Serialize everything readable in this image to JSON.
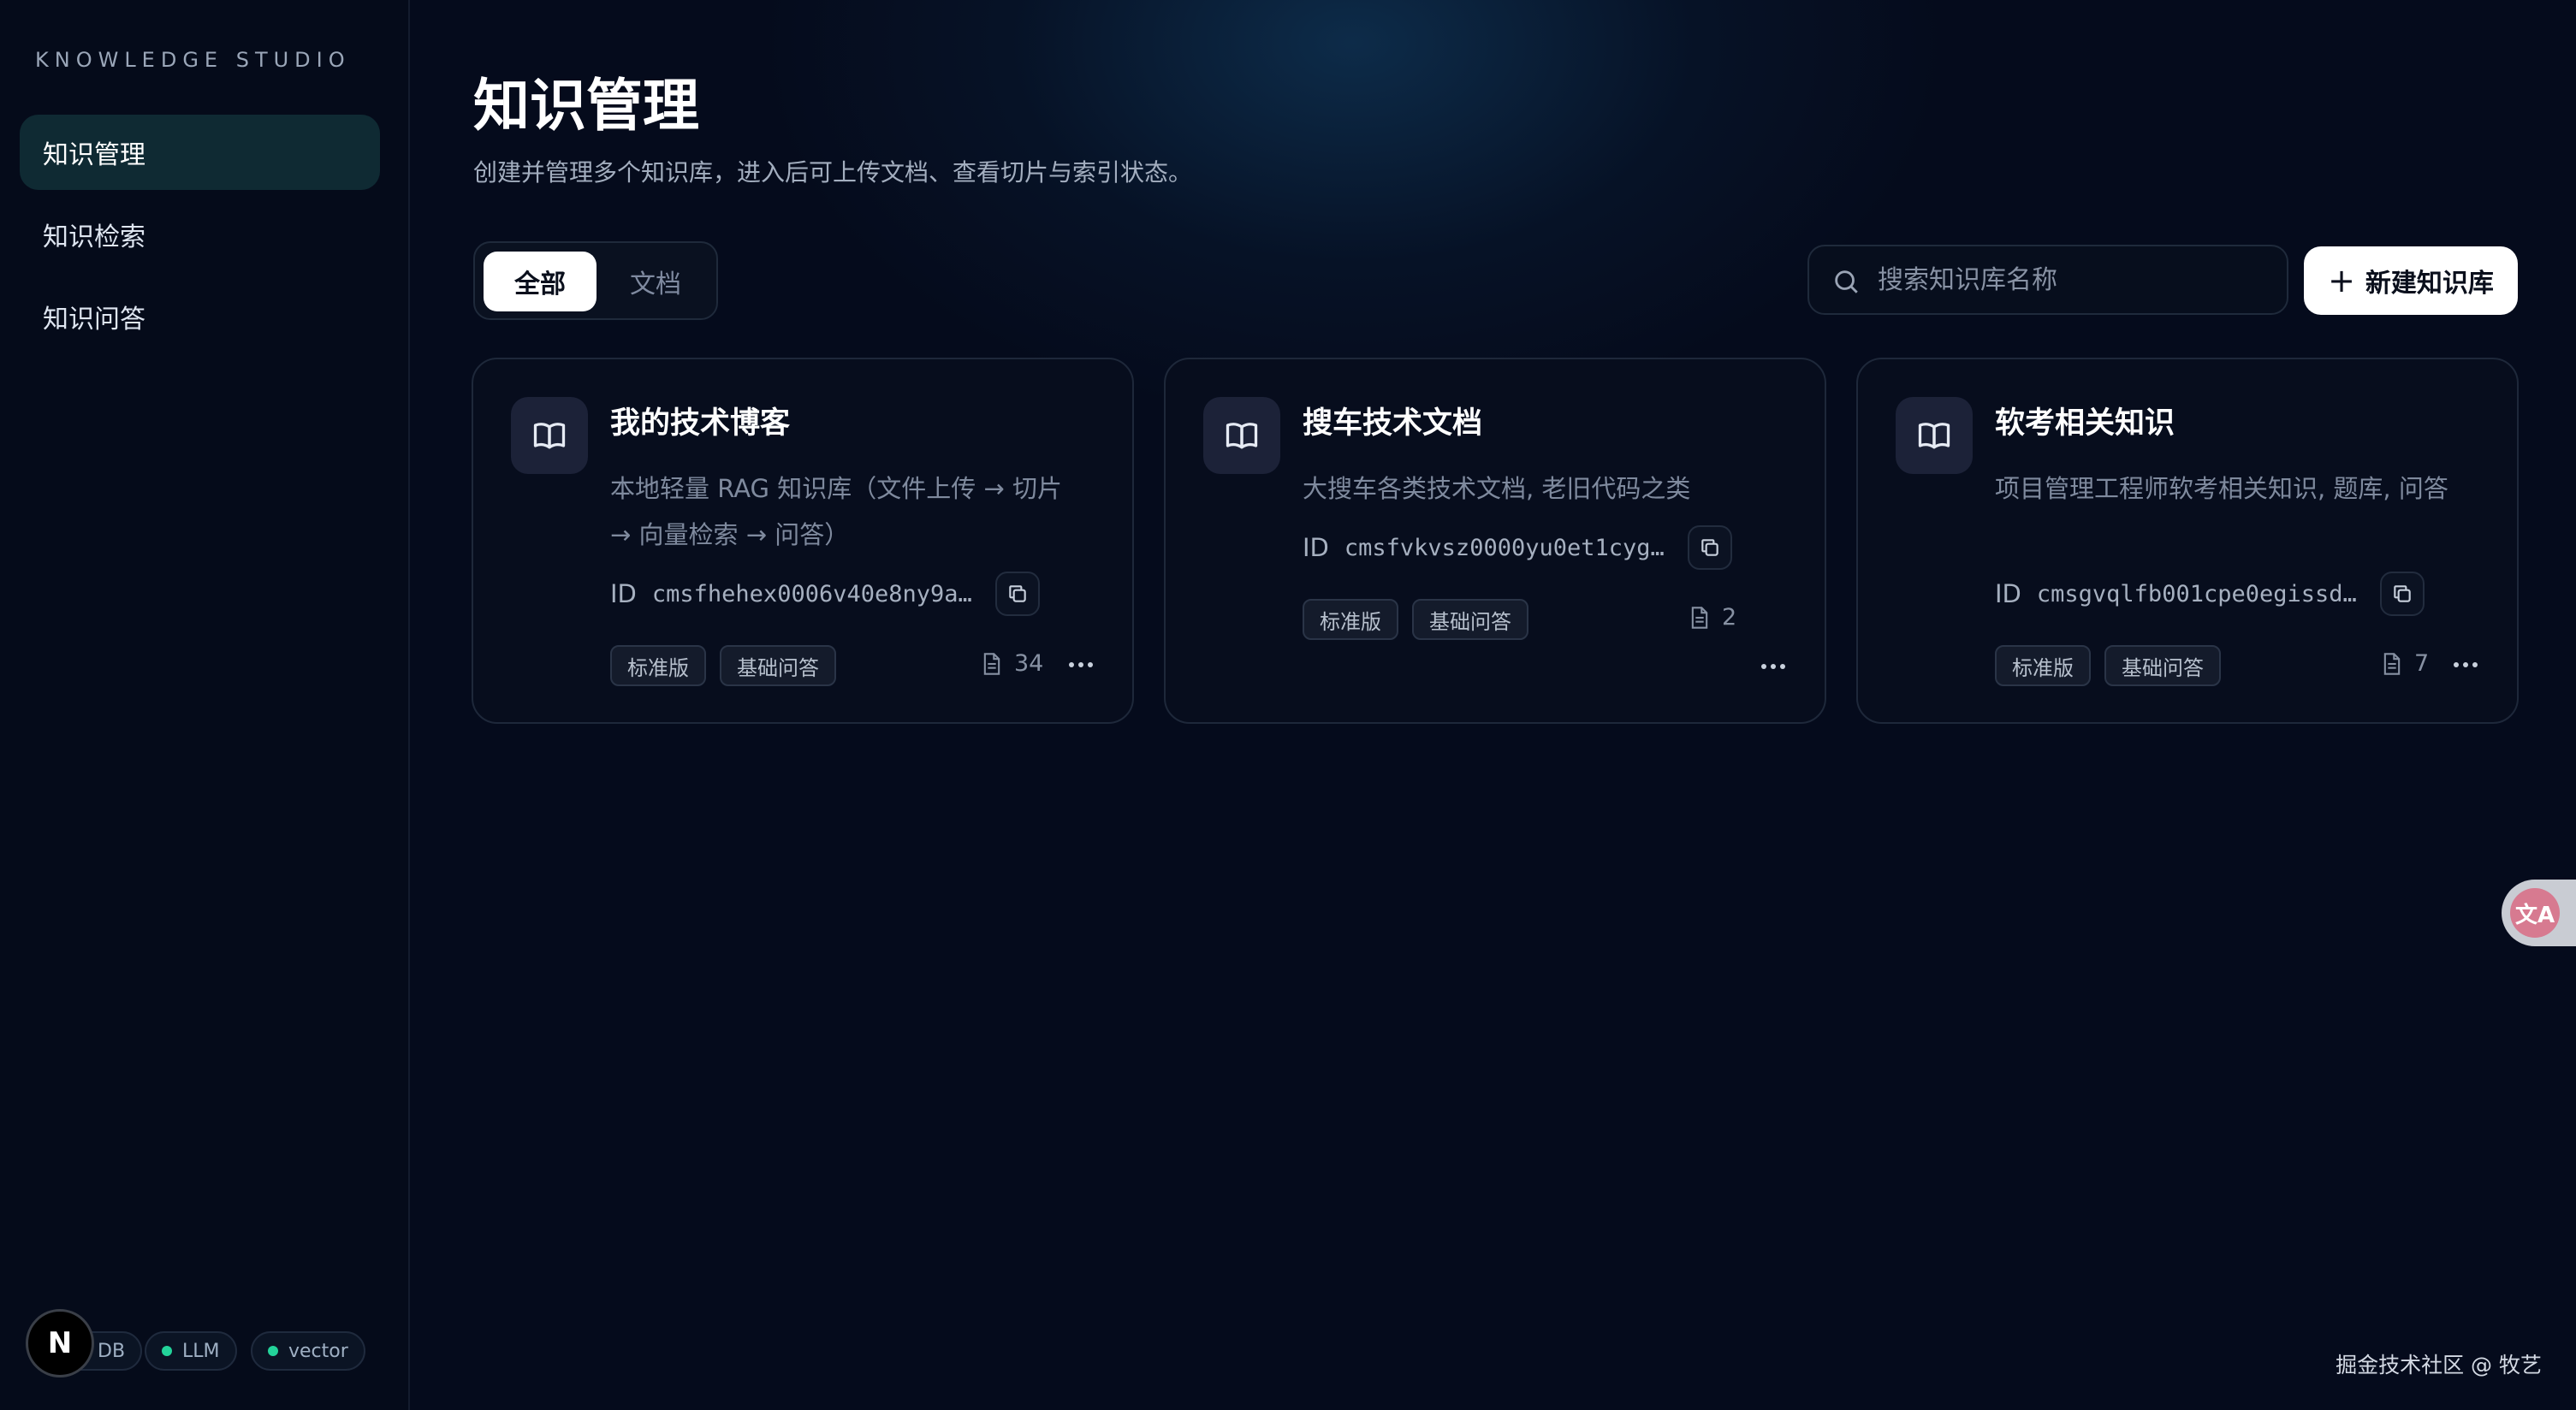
{
  "sidebar": {
    "brand": "KNOWLEDGE STUDIO",
    "items": [
      {
        "label": "知识管理",
        "active": true
      },
      {
        "label": "知识检索",
        "active": false
      },
      {
        "label": "知识问答",
        "active": false
      }
    ],
    "status": [
      {
        "label": "DB",
        "color": "#23d39a"
      },
      {
        "label": "LLM",
        "color": "#23d39a"
      },
      {
        "label": "vector",
        "color": "#23d39a"
      }
    ],
    "next_badge": "N"
  },
  "header": {
    "title": "知识管理",
    "subtitle": "创建并管理多个知识库，进入后可上传文档、查看切片与索引状态。"
  },
  "filters": {
    "tabs": [
      {
        "label": "全部",
        "active": true
      },
      {
        "label": "文档",
        "active": false
      }
    ]
  },
  "search": {
    "placeholder": "搜索知识库名称",
    "value": ""
  },
  "actions": {
    "new_label": "新建知识库"
  },
  "cards": [
    {
      "title": "我的技术博客",
      "description": "本地轻量 RAG 知识库（文件上传 → 切片 → 向量检索 → 问答）",
      "id_label": "ID",
      "id": "cmsfhehex0006v40e8ny9a4…",
      "tags": [
        "标准版",
        "基础问答"
      ],
      "doc_count": "34"
    },
    {
      "title": "搜车技术文档",
      "description": "大搜车各类技术文档, 老旧代码之类",
      "id_label": "ID",
      "id": "cmsfvkvsz0000yu0et1cygo…",
      "tags": [
        "标准版",
        "基础问答"
      ],
      "doc_count": "2"
    },
    {
      "title": "软考相关知识",
      "description": "项目管理工程师软考相关知识, 题库, 问答",
      "id_label": "ID",
      "id": "cmsgvqlfb001cpe0egissdr…",
      "tags": [
        "标准版",
        "基础问答"
      ],
      "doc_count": "7"
    }
  ],
  "translate_fab": "文A",
  "footer": {
    "credit": "掘金技术社区 @ 牧艺"
  },
  "colors": {
    "background": "#050b1c",
    "accent_active": "#0f2a33",
    "status_ok": "#23d39a"
  }
}
